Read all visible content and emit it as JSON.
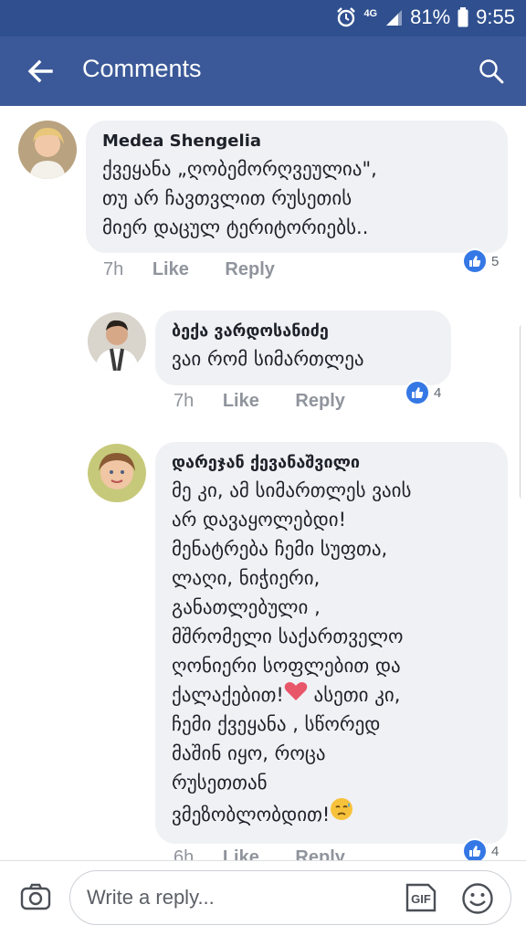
{
  "status_bar": {
    "network": "4G",
    "battery": "81%",
    "time": "9:55",
    "icons": [
      "alarm-icon",
      "signal-icon",
      "battery-icon"
    ]
  },
  "app_bar": {
    "title": "Comments",
    "icons": [
      "back-arrow-icon",
      "search-icon"
    ]
  },
  "comments": [
    {
      "author": "Medea Shengelia",
      "text": "ქვეყანა „ღობემორღვეულია\",\nთუ არ ჩავთვლით რუსეთის\nმიერ დაცულ ტერიტორიებს..",
      "time": "7h",
      "like_label": "Like",
      "reply_label": "Reply",
      "reaction_count": "5"
    },
    {
      "author": "ბექა ვარდოსანიძე",
      "text": "ვაი რომ სიმართლეა",
      "time": "7h",
      "like_label": "Like",
      "reply_label": "Reply",
      "reaction_count": "4"
    },
    {
      "author": "დარეჯან ქევანაშვილი",
      "text_lines": [
        "მე კი, ამ სიმართლეს ვაის",
        "არ დავაყოლებდი!",
        "მენატრება ჩემი სუფთა,",
        "ლაღი, ნიჭიერი,",
        "განათლებული ,",
        "მშრომელი  საქართველო",
        "ღონიერი სოფლებით და",
        "ქალაქებით!",
        " ასეთი კი,",
        "ჩემი ქვეყანა , სწორედ",
        "მაშინ იყო, როცა",
        "რუსეთთან",
        "ვმეზობლობდით!"
      ],
      "time": "6h",
      "like_label": "Like",
      "reply_label": "Reply",
      "reaction_count": "4"
    }
  ],
  "composer": {
    "placeholder": "Write a reply...",
    "gif_label": "GIF",
    "icons": [
      "camera-icon",
      "gif-icon",
      "smiley-icon"
    ]
  },
  "colors": {
    "app_bar": "#3b5998",
    "status_bar": "#2f4f8f",
    "bubble": "#f0f1f4",
    "like_blue": "#3578e5"
  }
}
